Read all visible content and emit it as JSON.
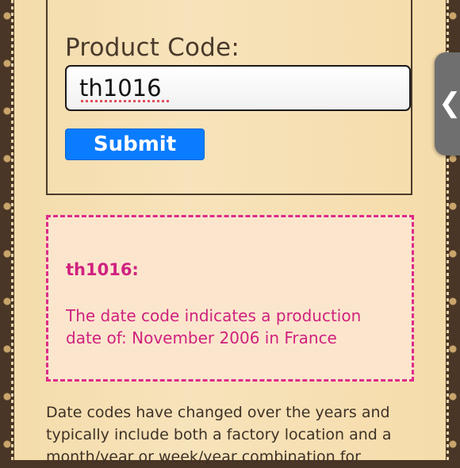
{
  "form": {
    "label": "Product Code:",
    "input_value": "th1016",
    "submit_label": "Submit"
  },
  "result": {
    "code_heading": "th1016:",
    "message": "The date code indicates a production date of: November 2006 in France"
  },
  "info": {
    "text": "Date codes have changed over the years and typically include both a factory location and a month/year or week/year combination for"
  },
  "side_tab": {
    "icon": "chevron-left-icon",
    "glyph": "❮"
  },
  "colors": {
    "accent_button": "#0a7cff",
    "result_text": "#d0217f",
    "result_border": "#de2a8a",
    "page_background": "#f5deaf"
  }
}
